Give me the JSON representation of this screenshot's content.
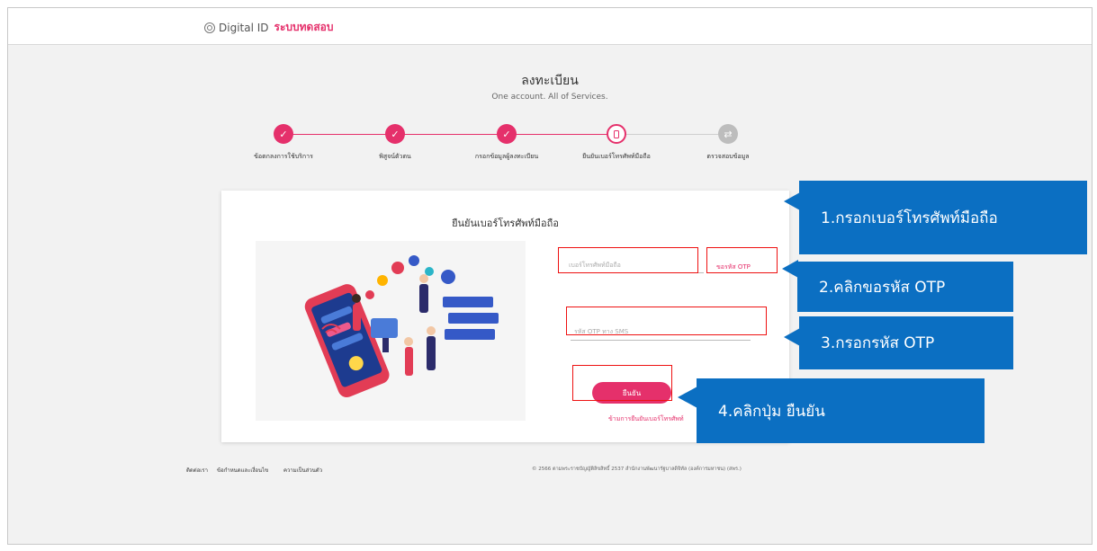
{
  "header": {
    "brand": "Digital ID",
    "environment": "ระบบทดสอบ"
  },
  "page": {
    "title": "ลงทะเบียน",
    "subtitle": "One account. All of Services."
  },
  "steps": [
    {
      "label": "ข้อตกลงการใช้บริการ",
      "status": "done"
    },
    {
      "label": "พิสูจน์ตัวตน",
      "status": "done"
    },
    {
      "label": "กรอกข้อมูลผู้ลงทะเบียน",
      "status": "done"
    },
    {
      "label": "ยืนยันเบอร์โทรศัพท์มือถือ",
      "status": "current"
    },
    {
      "label": "ตรวจสอบข้อมูล",
      "status": "todo"
    }
  ],
  "form": {
    "title": "ยืนยันเบอร์โทรศัพท์มือถือ",
    "phone_placeholder": "เบอร์โทรศัพท์มือถือ",
    "request_otp": "ขอรหัส OTP",
    "otp_placeholder": "รหัส OTP ทาง SMS",
    "confirm_button": "ยืนยัน",
    "skip_link": "ข้ามการยืนยันเบอร์โทรศัพท์"
  },
  "footer": {
    "links": [
      "ติดต่อเรา",
      "ข้อกำหนดและเงื่อนไข",
      "ความเป็นส่วนตัว"
    ],
    "copyright": "© 2566 ตามพระราชบัญญัติลิขสิทธิ์ 2537 สำนักงานพัฒนารัฐบาลดิจิทัล (องค์การมหาชน) (สพร.)"
  },
  "callouts": [
    "1.กรอกเบอร์โทรศัพท์มือถือ",
    "2.คลิกขอรหัส OTP",
    "3.กรอกรหัส OTP",
    "4.คลิกปุ่ม ยืนยัน"
  ],
  "colors": {
    "accent": "#e5306b",
    "callout": "#0b6fc2",
    "highlight": "#ee1111"
  }
}
